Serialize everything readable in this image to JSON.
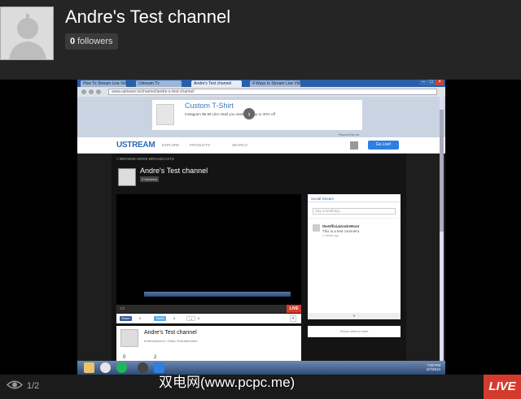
{
  "header": {
    "channel_title": "Andre's Test channel",
    "followers_count": "0",
    "followers_label": "followers"
  },
  "screenshot": {
    "tabs": [
      "How To Stream Live Vid...",
      "Ustream Tv",
      "Andre's Test channel",
      "4 Ways to Stream Live Vid..."
    ],
    "address": "www.ustream.tv/channel/andre-s-test-channel",
    "ad": {
      "title": "Custom T-Shirt",
      "sub": "Instagram  $6.99  Like retail you seek? Get up to 30% off",
      "caption": "Report this ad"
    },
    "nav": {
      "logo": "USTREAM",
      "explore": "EXPLORE",
      "products": "PRODUCTS",
      "search": "SEARCH",
      "go_live": "Go Live!"
    },
    "back_link": "< BROWSE MORE BROADCASTS",
    "channel_title": "Andre's Test channel",
    "followers": "0 followers",
    "video": {
      "views": "1/2",
      "live": "LIVE"
    },
    "share": {
      "facebook": "Share",
      "facebook_count": "0",
      "twitter": "Tweet",
      "twitter_count": "0",
      "gplus": "+1",
      "gplus_count": "0"
    },
    "social": {
      "tab": "Social Stream",
      "input_placeholder": "Say something...",
      "post_user": "theOfficialAndreRoot",
      "post_text": "This is a test comment",
      "post_time": "1 minute ago",
      "footer": "▼"
    },
    "info": {
      "title": "Andre's Test channel",
      "meta": "Entertainment • Other, Entertainment",
      "stat1": "0",
      "stat2": "2"
    },
    "side_card": "Status without stats",
    "clock_time": "7:00 PM",
    "clock_date": "4/7/2014"
  },
  "watermark": "双电网(www.pcpc.me)",
  "bottom": {
    "viewer_count": "1/2",
    "live_label": "LIVE"
  },
  "colors": {
    "live_red": "#d53b2d",
    "header_bg": "#252525",
    "brand_blue": "#2d6bb5"
  }
}
